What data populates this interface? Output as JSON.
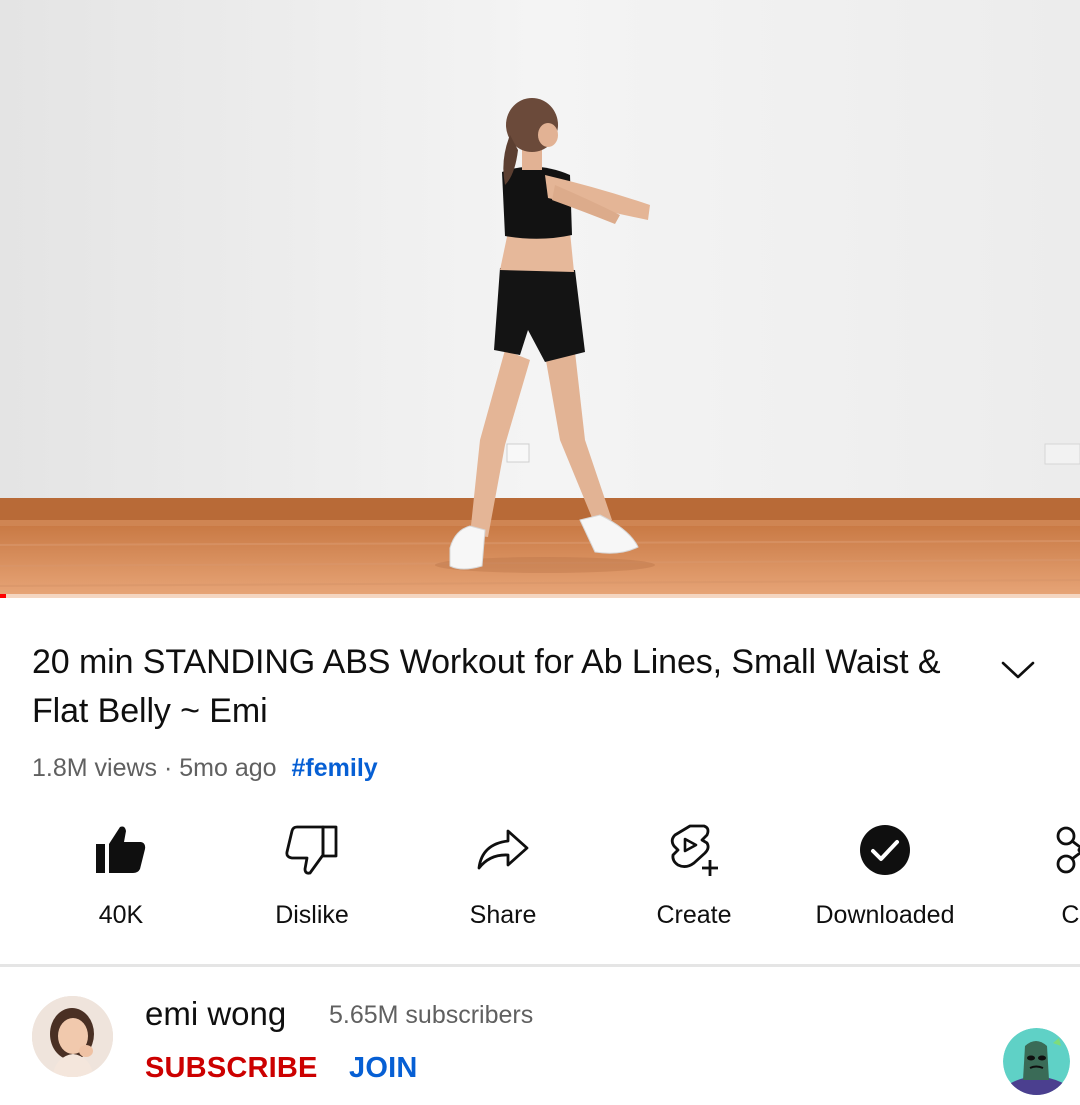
{
  "video": {
    "progress_fraction": 0.005
  },
  "title": {
    "text": "20 min STANDING ABS Workout for Ab Lines, Small Waist & Flat Belly ~ Emi"
  },
  "meta": {
    "views": "1.8M views",
    "separator": "·",
    "age": "5mo ago",
    "hashtag": "#femily"
  },
  "actions": [
    {
      "label": "40K",
      "icon": "thumbs-up-filled-icon"
    },
    {
      "label": "Dislike",
      "icon": "thumbs-down-outline-icon"
    },
    {
      "label": "Share",
      "icon": "share-arrow-icon"
    },
    {
      "label": "Create",
      "icon": "create-shorts-icon"
    },
    {
      "label": "Downloaded",
      "icon": "downloaded-check-icon"
    },
    {
      "label": "Cli",
      "icon": "clip-scissors-icon"
    }
  ],
  "channel": {
    "name": "emi wong",
    "subscribers": "5.65M subscribers",
    "subscribe_label": "SUBSCRIBE",
    "join_label": "JOIN"
  },
  "colors": {
    "progress": "#ff0000",
    "subscribe": "#cc0000",
    "join": "#065fd4",
    "hashtag": "#065fd4",
    "secondary_text": "#606060"
  }
}
